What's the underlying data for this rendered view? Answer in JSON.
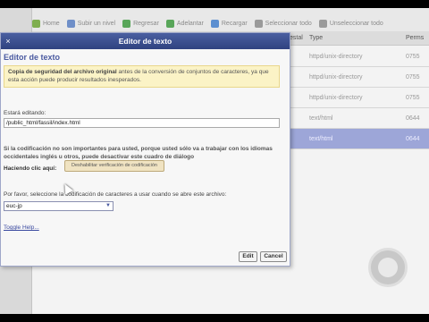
{
  "toolbar": {
    "items": [
      {
        "label": "Home",
        "icon": "home-icon",
        "color": "#7fae4f"
      },
      {
        "label": "Subir un nivel",
        "icon": "up-level-icon",
        "color": "#6f8fc8"
      },
      {
        "label": "Regresar",
        "icon": "back-icon",
        "color": "#59a65a"
      },
      {
        "label": "Adelantar",
        "icon": "forward-icon",
        "color": "#59a65a"
      },
      {
        "label": "Recargar",
        "icon": "reload-icon",
        "color": "#5c8fd0"
      },
      {
        "label": "Seleccionar todo",
        "icon": "checkbox-icon",
        "color": "#9a9a9a"
      },
      {
        "label": "Unseleccionar todo",
        "icon": "checkbox-icon",
        "color": "#9a9a9a"
      }
    ]
  },
  "file_table": {
    "headers": {
      "partial": "estal",
      "type": "Type",
      "perms": "Perms"
    },
    "rows": [
      {
        "type": "httpd/unix-directory",
        "perms": "0755",
        "selected": false
      },
      {
        "type": "httpd/unix-directory",
        "perms": "0755",
        "selected": false
      },
      {
        "type": "httpd/unix-directory",
        "perms": "0755",
        "selected": false
      },
      {
        "type": "text/html",
        "perms": "0644",
        "selected": false
      },
      {
        "type": "text/html",
        "perms": "0644",
        "selected": true
      }
    ]
  },
  "dialog": {
    "title": "Editor de texto",
    "close_glyph": "×",
    "heading": "Editor de texto",
    "warning_bold": "Copia de seguridad del archivo original",
    "warning_rest": " antes de la conversión de conjuntos de caracteres, ya que esta acción puede producir resultados inesperados.",
    "editing_label": "Estará editando:",
    "path": "/public_html/fassil/index.html",
    "info_bold": "Si la codificación no son importantes para usted, porque usted sólo va a trabajar con los idiomas occidentales inglés u otros, puede desactivar este cuadro de diálogo",
    "click_label": "Haciendo clic aquí:",
    "disable_button": "Deshabilitar verificación de codificación",
    "select_prompt": "Por favor, seleccione la codificación de caracteres a usar cuando se abre este archivo:",
    "encoding": "euc-jp",
    "toggle_help": "Toggle Help...",
    "edit_button": "Edit",
    "cancel_button": "Cancel"
  }
}
